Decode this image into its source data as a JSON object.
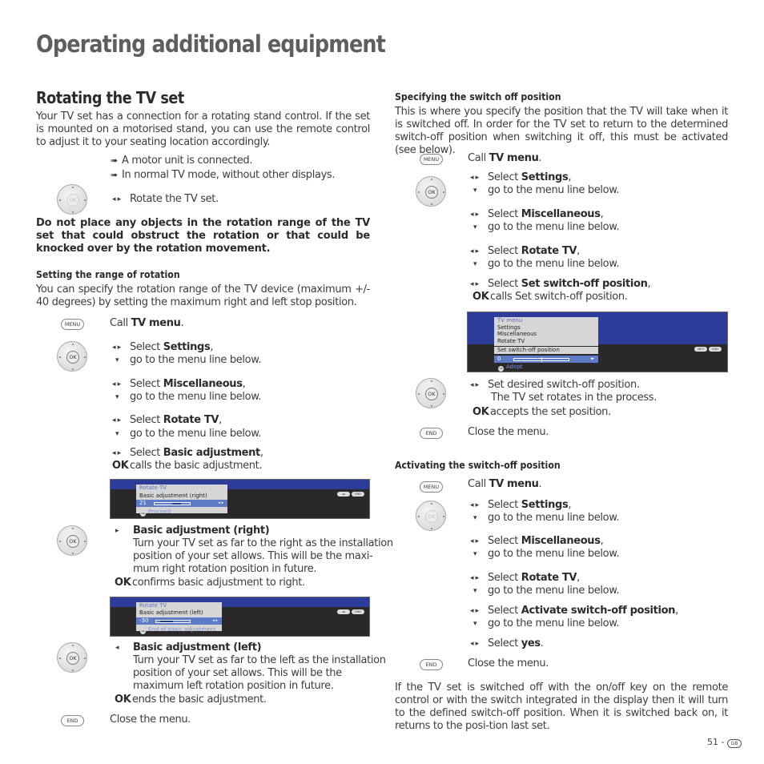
{
  "page": {
    "title": "Operating additional equipment",
    "page_number": "51 -",
    "language_badge": "GB"
  },
  "left": {
    "section_title": "Rotating the TV set",
    "intro": "Your TV set has a connection for a rotating stand control. If the set is mounted on a motorised stand, you can use the remote control to adjust it to your seating location accordingly.",
    "prereqs": [
      "A motor unit is connected.",
      "In normal TV mode, without other displays."
    ],
    "rotate_step": "Rotate the TV set.",
    "warning": "Do not place any objects in the rotation range of the TV set that could obstruct the rotation or that could be knocked over by the rotation movement.",
    "range_heading": "Setting the range of rotation",
    "range_text": "You can specify the rotation range of the TV device (maximum +/- 40 degrees) by setting the maximum right and left stop position.",
    "steps": {
      "call": "Call ",
      "tv_menu": "TV menu",
      "select": "Select ",
      "settings": "Settings",
      "miscellaneous": "Miscellaneous",
      "rotate_tv": "Rotate TV",
      "basic_adjustment": "Basic adjustment",
      "go_below": "go to the menu line below.",
      "calls_basic": "calls the basic adjustment."
    },
    "osd_right": {
      "title": "Rotate TV",
      "item": "Basic adjustment (right)",
      "value": "21",
      "value_fraction": 0.76,
      "hint": "Proceed",
      "keys": [
        "◂◂",
        "END"
      ]
    },
    "right_adj": {
      "heading": "Basic adjustment (right)",
      "lines": [
        "Turn your TV set as far to the right as the installation",
        "position of your set allows. This will be the maxi-",
        "mum right rotation position in future."
      ],
      "ok_text": "confirms basic adjustment to right."
    },
    "osd_left": {
      "title": "Rotate TV",
      "item": "Basic adjustment (left)",
      "value": "-30",
      "value_fraction": 0.13,
      "hint": "End of basic adjustment",
      "keys": [
        "◂◂",
        "END"
      ]
    },
    "left_adj": {
      "heading": "Basic adjustment (left)",
      "lines": [
        "Turn your TV set as far to the left as the installation",
        "position of your set allows. This will be the",
        "maximum left rotation position in future."
      ],
      "ok_text": "ends the basic adjustment."
    },
    "close": "Close the menu."
  },
  "right": {
    "switch_off_heading": "Specifying the switch off position",
    "switch_off_text": "This is where you specify the position that the TV will take when it is switched off. In order for the TV set to return to the determined switch-off position when switching it off, this must be activated (see below).",
    "set_switch_off": "Set switch-off position",
    "calls_set": "calls Set switch-off position.",
    "osd": {
      "items": [
        "TV menu",
        "Settings",
        "Miscellaneous",
        "Rotate TV"
      ],
      "selected": "Set switch-off position",
      "value": "0",
      "value_fraction": 0.5,
      "hint": "Adopt",
      "keys": [
        "INFO",
        "END"
      ]
    },
    "set_desired": [
      "Set desired switch-off position.",
      "The TV set rotates in the process."
    ],
    "accepts": "accepts the set position.",
    "activating_heading": "Activating the switch-off position",
    "activate_item": "Activate switch-off position",
    "yes": "yes",
    "final_text": "If the TV set is switched off with the on/off key on the remote control or with the switch integrated in the display then it will turn to the defined switch-off position. When it is switched back on, it returns to the posi-tion last set."
  },
  "keys": {
    "menu": "MENU",
    "ok": "OK",
    "end": "END",
    "ok_bold": "OK"
  },
  "icons": {
    "left_right": "◂ ▸",
    "down": "▾",
    "right": "▸",
    "left": "◂",
    "arrow_bullet": "➠"
  }
}
